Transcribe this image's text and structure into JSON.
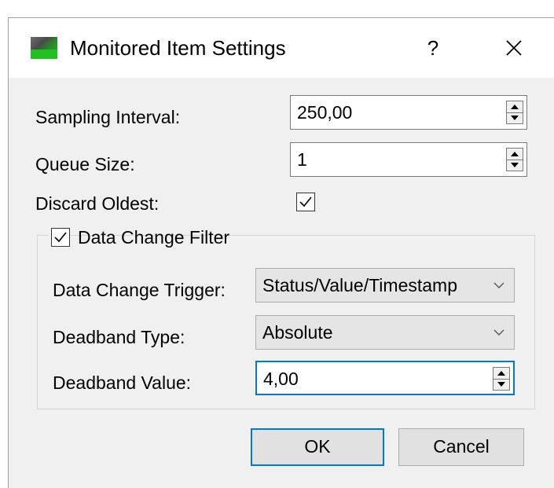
{
  "window": {
    "title": "Monitored Item Settings",
    "help_label": "?",
    "app_icon": "app-icon-green",
    "close_icon": "close-icon"
  },
  "fields": {
    "sampling_interval": {
      "label": "Sampling Interval:",
      "value": "250,00"
    },
    "queue_size": {
      "label": "Queue Size:",
      "value": "1"
    },
    "discard_oldest": {
      "label": "Discard Oldest:",
      "checked": true
    }
  },
  "filter": {
    "label": "Data Change Filter",
    "checked": true,
    "trigger": {
      "label": "Data Change Trigger:",
      "value": "Status/Value/Timestamp"
    },
    "deadband_type": {
      "label": "Deadband Type:",
      "value": "Absolute"
    },
    "deadband_value": {
      "label": "Deadband Value:",
      "value": "4,00"
    }
  },
  "buttons": {
    "ok": "OK",
    "cancel": "Cancel"
  },
  "colors": {
    "focus_accent": "#0078d7",
    "dialog_bg": "#f0f0f0",
    "icon_green": "#22c022"
  }
}
